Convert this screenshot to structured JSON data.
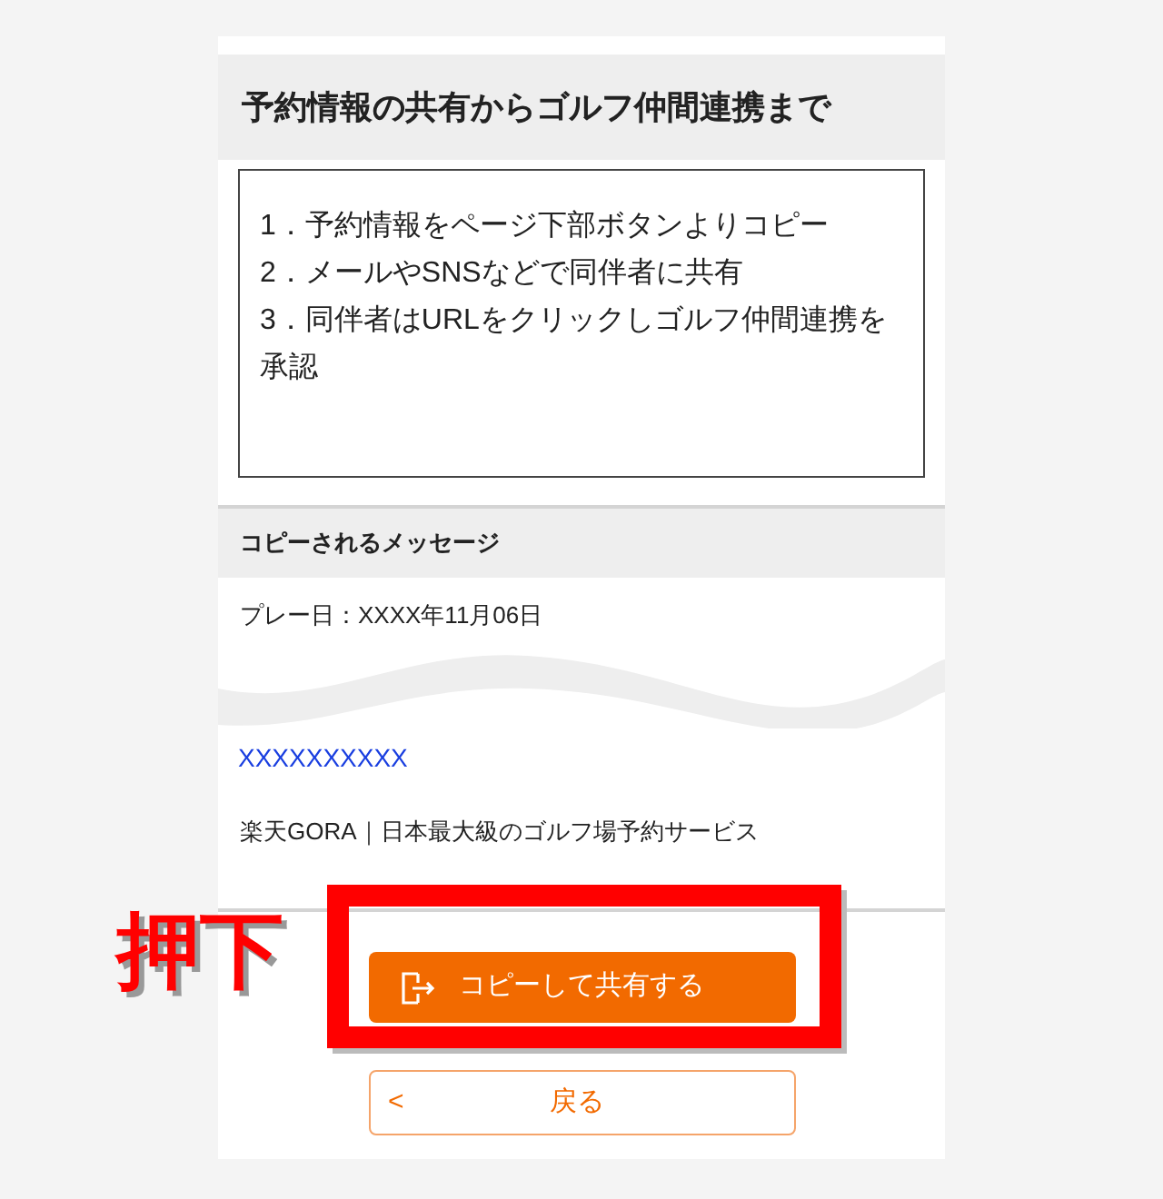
{
  "section_title": "予約情報の共有からゴルフ仲間連携まで",
  "steps": [
    "1．予約情報をページ下部ボタンよりコピー",
    "2．メールやSNSなどで同伴者に共有",
    "3．同伴者はURLをクリックしゴルフ仲間連携を承認"
  ],
  "message_section": {
    "title": "コピーされるメッセージ",
    "play_date": "プレー日：XXXX年11月06日",
    "link": "XXXXXXXXXX",
    "footer": "楽天GORA｜日本最大級のゴルフ場予約サービス"
  },
  "buttons": {
    "share": "コピーして共有する",
    "back": "戻る",
    "back_icon": "<"
  },
  "annotation": {
    "label": "押下"
  }
}
